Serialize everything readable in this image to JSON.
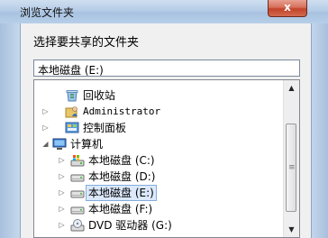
{
  "window": {
    "title": "浏览文件夹",
    "close_glyph": "x"
  },
  "dialog": {
    "prompt": "选择要共享的文件夹",
    "path_value": "本地磁盘 (E:)"
  },
  "tree": {
    "items": [
      {
        "label": "回收站",
        "icon": "recycle-bin-icon"
      },
      {
        "label": "Administrator",
        "icon": "user-folder-icon",
        "expander": "▷"
      },
      {
        "label": "控制面板",
        "icon": "control-panel-icon",
        "expander": "▷"
      },
      {
        "label": "计算机",
        "icon": "computer-icon",
        "expander": "◢",
        "expanded": true
      },
      {
        "label": "本地磁盘 (C:)",
        "icon": "system-drive-icon",
        "expander": "▷"
      },
      {
        "label": "本地磁盘 (D:)",
        "icon": "drive-icon",
        "expander": "▷"
      },
      {
        "label": "本地磁盘 (E:)",
        "icon": "drive-icon",
        "expander": "▷",
        "selected": true
      },
      {
        "label": "本地磁盘 (F:)",
        "icon": "drive-icon",
        "expander": "▷"
      },
      {
        "label": "DVD 驱动器 (G:)",
        "icon": "dvd-drive-icon",
        "expander": "▷"
      }
    ]
  },
  "scrollbar": {
    "up": "▲",
    "down": "▼",
    "grip": "≡"
  },
  "colors": {
    "selection_fill": "#dbe9fb",
    "selection_border": "#84acdd",
    "close_red": "#c2432a",
    "title_blue": "#b5cce6"
  }
}
